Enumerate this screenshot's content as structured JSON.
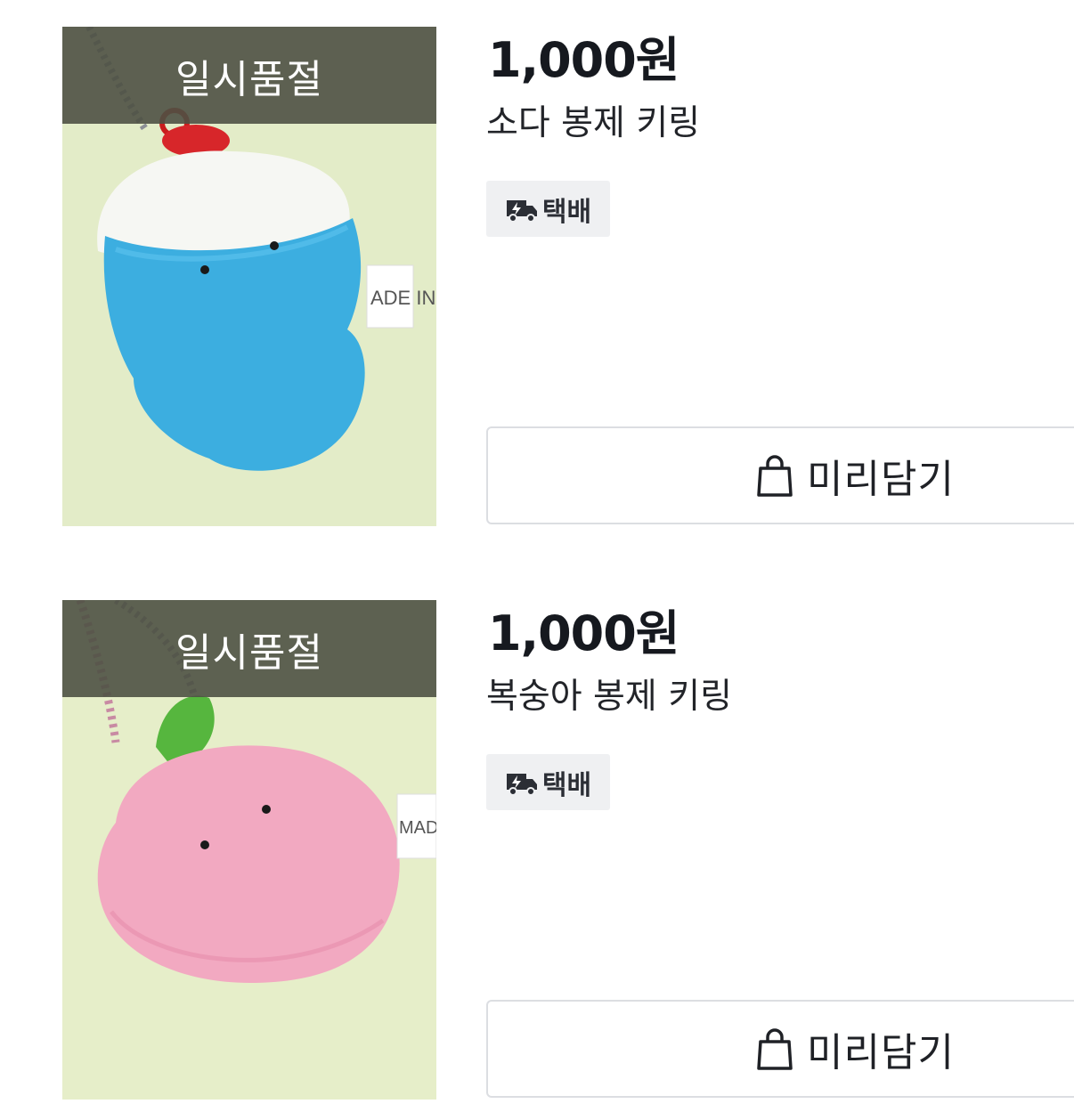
{
  "products": [
    {
      "soldout_label": "일시품절",
      "price": "1,000원",
      "name": "소다 봉제 키링",
      "delivery_label": "택배",
      "button_label": "미리담기",
      "tag_text": "ADE IN"
    },
    {
      "soldout_label": "일시품절",
      "price": "1,000원",
      "name": "복숭아 봉제 키링",
      "delivery_label": "택배",
      "button_label": "미리담기",
      "tag_text": "MADE"
    }
  ],
  "colors": {
    "soldout_band": "#4e5144",
    "badge_bg": "#eff0f2",
    "button_border": "#dcdee2",
    "text_primary": "#16191f"
  },
  "icons": {
    "delivery": "truck-lightning-icon",
    "prebag": "shopping-bag-icon"
  }
}
